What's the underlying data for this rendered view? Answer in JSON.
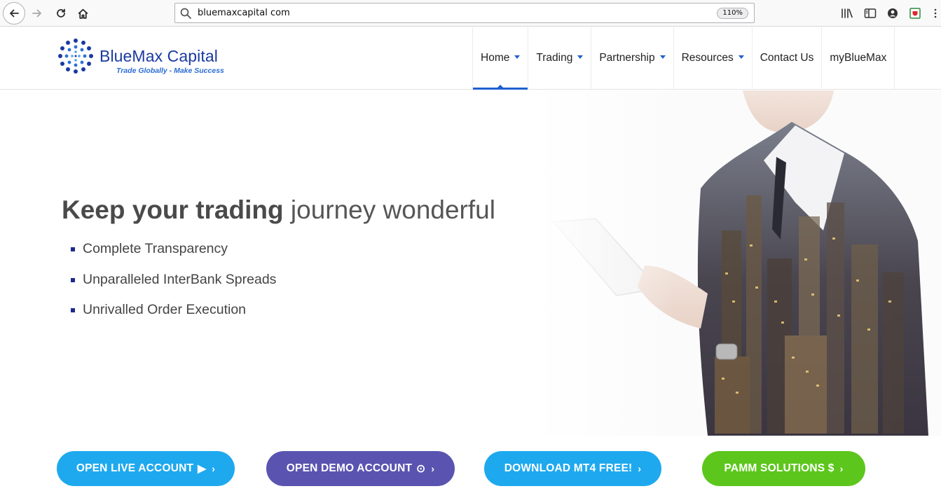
{
  "browser": {
    "url": "bluemaxcapital com",
    "zoom": "110%"
  },
  "logo": {
    "name": "BlueMax Capital",
    "tagline": "Trade Globally - Make Success"
  },
  "nav": {
    "items": [
      {
        "label": "Home",
        "dropdown": true,
        "active": true
      },
      {
        "label": "Trading",
        "dropdown": true
      },
      {
        "label": "Partnership",
        "dropdown": true
      },
      {
        "label": "Resources",
        "dropdown": true
      },
      {
        "label": "Contact Us",
        "dropdown": false
      },
      {
        "label": "myBlueMax",
        "dropdown": false
      }
    ]
  },
  "hero": {
    "heading_bold": "Keep your trading",
    "heading_light": "journey wonderful",
    "bullets": [
      "Complete Transparency",
      "Unparalleled InterBank Spreads",
      "Unrivalled Order Execution"
    ]
  },
  "cta": {
    "live": {
      "label": "OPEN LIVE ACCOUNT",
      "symbol": "▶",
      "chevron": "›",
      "color": "#1ea9ef"
    },
    "demo": {
      "label": "OPEN DEMO ACCOUNT",
      "symbol": "⊙",
      "chevron": "›",
      "color": "#5a54b0"
    },
    "mt4": {
      "label": "DOWNLOAD MT4 FREE!",
      "chevron": "›",
      "color": "#1ea9ef"
    },
    "pamm": {
      "label": "PAMM SOLUTIONS $",
      "chevron": "›",
      "color": "#5dc61c"
    }
  },
  "colors": {
    "brand_blue": "#1a3aa0",
    "nav_accent": "#1f5fd1"
  }
}
